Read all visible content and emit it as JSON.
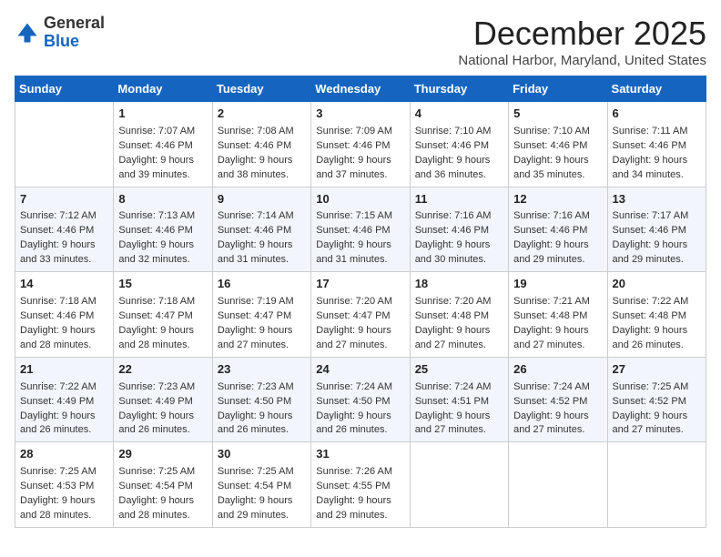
{
  "header": {
    "logo_general": "General",
    "logo_blue": "Blue",
    "month": "December 2025",
    "location": "National Harbor, Maryland, United States"
  },
  "weekdays": [
    "Sunday",
    "Monday",
    "Tuesday",
    "Wednesday",
    "Thursday",
    "Friday",
    "Saturday"
  ],
  "weeks": [
    [
      {
        "day": null,
        "content": null
      },
      {
        "day": "1",
        "sunrise": "Sunrise: 7:07 AM",
        "sunset": "Sunset: 4:46 PM",
        "daylight": "Daylight: 9 hours and 39 minutes."
      },
      {
        "day": "2",
        "sunrise": "Sunrise: 7:08 AM",
        "sunset": "Sunset: 4:46 PM",
        "daylight": "Daylight: 9 hours and 38 minutes."
      },
      {
        "day": "3",
        "sunrise": "Sunrise: 7:09 AM",
        "sunset": "Sunset: 4:46 PM",
        "daylight": "Daylight: 9 hours and 37 minutes."
      },
      {
        "day": "4",
        "sunrise": "Sunrise: 7:10 AM",
        "sunset": "Sunset: 4:46 PM",
        "daylight": "Daylight: 9 hours and 36 minutes."
      },
      {
        "day": "5",
        "sunrise": "Sunrise: 7:10 AM",
        "sunset": "Sunset: 4:46 PM",
        "daylight": "Daylight: 9 hours and 35 minutes."
      },
      {
        "day": "6",
        "sunrise": "Sunrise: 7:11 AM",
        "sunset": "Sunset: 4:46 PM",
        "daylight": "Daylight: 9 hours and 34 minutes."
      }
    ],
    [
      {
        "day": "7",
        "sunrise": "Sunrise: 7:12 AM",
        "sunset": "Sunset: 4:46 PM",
        "daylight": "Daylight: 9 hours and 33 minutes."
      },
      {
        "day": "8",
        "sunrise": "Sunrise: 7:13 AM",
        "sunset": "Sunset: 4:46 PM",
        "daylight": "Daylight: 9 hours and 32 minutes."
      },
      {
        "day": "9",
        "sunrise": "Sunrise: 7:14 AM",
        "sunset": "Sunset: 4:46 PM",
        "daylight": "Daylight: 9 hours and 31 minutes."
      },
      {
        "day": "10",
        "sunrise": "Sunrise: 7:15 AM",
        "sunset": "Sunset: 4:46 PM",
        "daylight": "Daylight: 9 hours and 31 minutes."
      },
      {
        "day": "11",
        "sunrise": "Sunrise: 7:16 AM",
        "sunset": "Sunset: 4:46 PM",
        "daylight": "Daylight: 9 hours and 30 minutes."
      },
      {
        "day": "12",
        "sunrise": "Sunrise: 7:16 AM",
        "sunset": "Sunset: 4:46 PM",
        "daylight": "Daylight: 9 hours and 29 minutes."
      },
      {
        "day": "13",
        "sunrise": "Sunrise: 7:17 AM",
        "sunset": "Sunset: 4:46 PM",
        "daylight": "Daylight: 9 hours and 29 minutes."
      }
    ],
    [
      {
        "day": "14",
        "sunrise": "Sunrise: 7:18 AM",
        "sunset": "Sunset: 4:46 PM",
        "daylight": "Daylight: 9 hours and 28 minutes."
      },
      {
        "day": "15",
        "sunrise": "Sunrise: 7:18 AM",
        "sunset": "Sunset: 4:47 PM",
        "daylight": "Daylight: 9 hours and 28 minutes."
      },
      {
        "day": "16",
        "sunrise": "Sunrise: 7:19 AM",
        "sunset": "Sunset: 4:47 PM",
        "daylight": "Daylight: 9 hours and 27 minutes."
      },
      {
        "day": "17",
        "sunrise": "Sunrise: 7:20 AM",
        "sunset": "Sunset: 4:47 PM",
        "daylight": "Daylight: 9 hours and 27 minutes."
      },
      {
        "day": "18",
        "sunrise": "Sunrise: 7:20 AM",
        "sunset": "Sunset: 4:48 PM",
        "daylight": "Daylight: 9 hours and 27 minutes."
      },
      {
        "day": "19",
        "sunrise": "Sunrise: 7:21 AM",
        "sunset": "Sunset: 4:48 PM",
        "daylight": "Daylight: 9 hours and 27 minutes."
      },
      {
        "day": "20",
        "sunrise": "Sunrise: 7:22 AM",
        "sunset": "Sunset: 4:48 PM",
        "daylight": "Daylight: 9 hours and 26 minutes."
      }
    ],
    [
      {
        "day": "21",
        "sunrise": "Sunrise: 7:22 AM",
        "sunset": "Sunset: 4:49 PM",
        "daylight": "Daylight: 9 hours and 26 minutes."
      },
      {
        "day": "22",
        "sunrise": "Sunrise: 7:23 AM",
        "sunset": "Sunset: 4:49 PM",
        "daylight": "Daylight: 9 hours and 26 minutes."
      },
      {
        "day": "23",
        "sunrise": "Sunrise: 7:23 AM",
        "sunset": "Sunset: 4:50 PM",
        "daylight": "Daylight: 9 hours and 26 minutes."
      },
      {
        "day": "24",
        "sunrise": "Sunrise: 7:24 AM",
        "sunset": "Sunset: 4:50 PM",
        "daylight": "Daylight: 9 hours and 26 minutes."
      },
      {
        "day": "25",
        "sunrise": "Sunrise: 7:24 AM",
        "sunset": "Sunset: 4:51 PM",
        "daylight": "Daylight: 9 hours and 27 minutes."
      },
      {
        "day": "26",
        "sunrise": "Sunrise: 7:24 AM",
        "sunset": "Sunset: 4:52 PM",
        "daylight": "Daylight: 9 hours and 27 minutes."
      },
      {
        "day": "27",
        "sunrise": "Sunrise: 7:25 AM",
        "sunset": "Sunset: 4:52 PM",
        "daylight": "Daylight: 9 hours and 27 minutes."
      }
    ],
    [
      {
        "day": "28",
        "sunrise": "Sunrise: 7:25 AM",
        "sunset": "Sunset: 4:53 PM",
        "daylight": "Daylight: 9 hours and 28 minutes."
      },
      {
        "day": "29",
        "sunrise": "Sunrise: 7:25 AM",
        "sunset": "Sunset: 4:54 PM",
        "daylight": "Daylight: 9 hours and 28 minutes."
      },
      {
        "day": "30",
        "sunrise": "Sunrise: 7:25 AM",
        "sunset": "Sunset: 4:54 PM",
        "daylight": "Daylight: 9 hours and 29 minutes."
      },
      {
        "day": "31",
        "sunrise": "Sunrise: 7:26 AM",
        "sunset": "Sunset: 4:55 PM",
        "daylight": "Daylight: 9 hours and 29 minutes."
      },
      {
        "day": null,
        "content": null
      },
      {
        "day": null,
        "content": null
      },
      {
        "day": null,
        "content": null
      }
    ]
  ]
}
